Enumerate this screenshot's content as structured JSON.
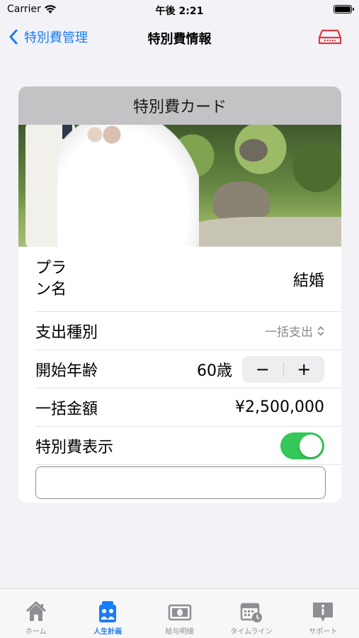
{
  "status_bar": {
    "carrier": "Carrier",
    "time": "午後 2:21"
  },
  "nav": {
    "back_label": "特別費管理",
    "title": "特別費情報",
    "right_icon": "hard-drive-icon"
  },
  "card": {
    "header": "特別費カード",
    "photo": "wedding-photo",
    "rows": {
      "plan": {
        "label": "プラン名",
        "value": "結婚"
      },
      "expense_type": {
        "label": "支出種別",
        "value": "一括支出"
      },
      "start_age": {
        "label": "開始年齢",
        "value": "60歳",
        "minus": "−",
        "plus": "+"
      },
      "lump_sum": {
        "label": "一括金額",
        "value": "¥2,500,000"
      },
      "display": {
        "label": "特別費表示",
        "on": true
      }
    },
    "text_field": {
      "value": "",
      "placeholder": ""
    }
  },
  "tab_bar": {
    "tabs": [
      {
        "label": "ホーム",
        "icon": "home-icon",
        "active": false
      },
      {
        "label": "人生計画",
        "icon": "family-icon",
        "active": true
      },
      {
        "label": "給与明細",
        "icon": "banknote-icon",
        "active": false
      },
      {
        "label": "タイムライン",
        "icon": "calendar-clock-icon",
        "active": false
      },
      {
        "label": "サポート",
        "icon": "info-bubble-icon",
        "active": false
      }
    ]
  },
  "colors": {
    "accent": "#1a7cf6",
    "toggle_on": "#34c759",
    "destructive_icon": "#e0393e",
    "card_header_bg": "#c3c3c6"
  }
}
